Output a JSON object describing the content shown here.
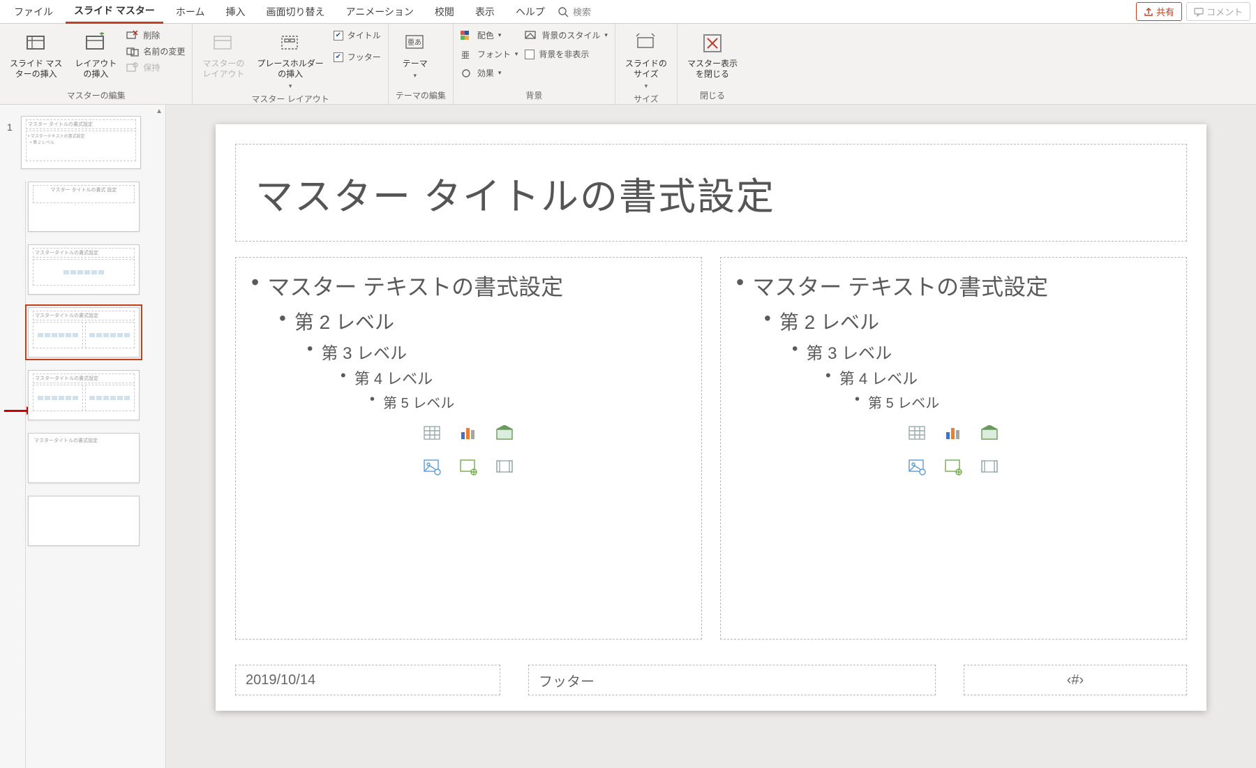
{
  "tabs": {
    "file": "ファイル",
    "slideMaster": "スライド マスター",
    "home": "ホーム",
    "insert": "挿入",
    "transitions": "画面切り替え",
    "animations": "アニメーション",
    "review": "校閲",
    "view": "表示",
    "help": "ヘルプ",
    "searchPlaceholder": "検索",
    "share": "共有",
    "comment": "コメント"
  },
  "ribbon": {
    "group_edit_master": "マスターの編集",
    "insert_slide_master": "スライド マス\nターの挿入",
    "insert_layout": "レイアウト\nの挿入",
    "delete": "削除",
    "rename": "名前の変更",
    "preserve": "保持",
    "group_master_layout": "マスター レイアウト",
    "master_layout_btn": "マスターの\nレイアウト",
    "insert_placeholder": "プレースホルダー\nの挿入",
    "chk_title": "タイトル",
    "chk_footer": "フッター",
    "group_edit_theme": "テーマの編集",
    "themes": "テーマ",
    "group_background": "背景",
    "colors": "配色",
    "fonts": "フォント",
    "effects": "効果",
    "bg_styles": "背景のスタイル",
    "hide_bg": "背景を非表示",
    "group_size": "サイズ",
    "slide_size": "スライドの\nサイズ",
    "group_close": "閉じる",
    "close_master": "マスター表示\nを閉じる"
  },
  "thumbs": {
    "master_number": "1",
    "master_title": "マスター タイトルの書式設定",
    "layout_title_short": "マスター タイトルの書式\n設定",
    "layout_title": "マスタータイトルの書式設定"
  },
  "slide": {
    "title": "マスター タイトルの書式設定",
    "level1": "マスター テキストの書式設定",
    "level2": "第 2 レベル",
    "level3": "第 3 レベル",
    "level4": "第 4 レベル",
    "level5": "第 5 レベル",
    "date": "2019/10/14",
    "footer": "フッター",
    "slidenum": "‹#›"
  }
}
